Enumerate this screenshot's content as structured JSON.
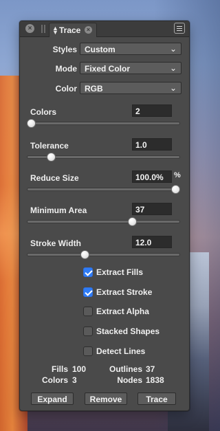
{
  "window": {
    "tab_label": "Trace"
  },
  "fields": {
    "styles": {
      "label": "Styles",
      "value": "Custom"
    },
    "mode": {
      "label": "Mode",
      "value": "Fixed Color"
    },
    "color": {
      "label": "Color",
      "value": "RGB"
    }
  },
  "sliders": [
    {
      "label": "Colors",
      "value": "2",
      "unit": "",
      "level": 0.0
    },
    {
      "label": "Tolerance",
      "value": "1.0",
      "unit": "",
      "level": 0.14
    },
    {
      "label": "Reduce Size",
      "value": "100.0%",
      "unit": "%",
      "level": 1.0
    },
    {
      "label": "Minimum Area",
      "value": "37",
      "unit": "",
      "level": 0.7
    },
    {
      "label": "Stroke Width",
      "value": "12.0",
      "unit": "",
      "level": 0.37
    }
  ],
  "checkboxes": [
    {
      "label": "Extract Fills",
      "checked": true
    },
    {
      "label": "Extract Stroke",
      "checked": true
    },
    {
      "label": "Extract Alpha",
      "checked": false
    },
    {
      "label": "Stacked Shapes",
      "checked": false
    },
    {
      "label": "Detect Lines",
      "checked": false
    }
  ],
  "stats": {
    "fills": {
      "label": "Fills",
      "value": "100"
    },
    "colors": {
      "label": "Colors",
      "value": "3"
    },
    "outlines": {
      "label": "Outlines",
      "value": "37"
    },
    "nodes": {
      "label": "Nodes",
      "value": "1838"
    }
  },
  "buttons": {
    "expand": "Expand",
    "remove": "Remove",
    "trace": "Trace"
  },
  "icons": {
    "close": "close-icon",
    "updown": "updown-icon",
    "menu": "menu-icon",
    "chevron": "chevron-down-icon",
    "check": "checkmark-icon"
  },
  "colors": {
    "panel_bg": "#4a4a4a",
    "accent_blue": "#2f7cf6"
  }
}
